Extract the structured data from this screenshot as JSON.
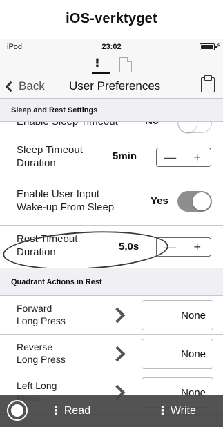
{
  "caption": "iOS-verktyget",
  "status_bar": {
    "device": "iPod",
    "time": "23:02",
    "charging": "⚡"
  },
  "nav": {
    "back_label": "Back",
    "title": "User Preferences"
  },
  "sections": {
    "sleep": "Sleep and Rest Settings",
    "quadrant": "Quadrant Actions in Rest"
  },
  "rows": {
    "enable_sleep_timeout": {
      "label": "Enable Sleep Timeout",
      "value": "No",
      "toggle_on": false
    },
    "sleep_timeout": {
      "label_line1": "Sleep Timeout",
      "label_line2": "Duration",
      "value": "5min",
      "minus": "—",
      "plus": "+"
    },
    "wakeup": {
      "label_line1": "Enable User Input",
      "label_line2": "Wake-up From Sleep",
      "value": "Yes",
      "toggle_on": true
    },
    "rest_timeout": {
      "label_line1": "Rest Timeout",
      "label_line2": "Duration",
      "value": "5,0s",
      "minus": "—",
      "plus": "+"
    }
  },
  "quadrant_rows": [
    {
      "line1": "Forward",
      "line2": "Long Press",
      "action": "None"
    },
    {
      "line1": "Reverse",
      "line2": "Long Press",
      "action": "None"
    },
    {
      "line1": "Left Long",
      "line2": "Press",
      "action": "None"
    }
  ],
  "bottom_bar": {
    "read_label": "Read",
    "write_label": "Write"
  },
  "icons": {
    "chair_tab": "wheelchair-icon",
    "doc_tab": "document-icon",
    "save": "clipboard-icon",
    "power": "power-icon",
    "read": "read-chair-icon",
    "write": "write-chair-icon"
  },
  "colors": {
    "toggle_on": "#8e8e8e",
    "bar": "#464646"
  }
}
